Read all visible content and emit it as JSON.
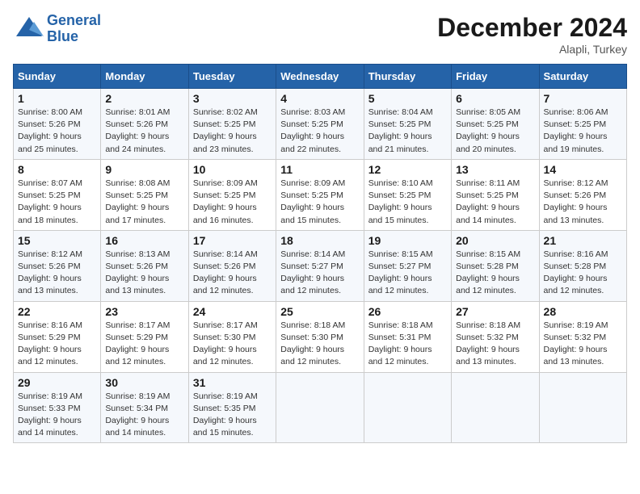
{
  "header": {
    "logo_line1": "General",
    "logo_line2": "Blue",
    "month_title": "December 2024",
    "location": "Alapli, Turkey"
  },
  "days_of_week": [
    "Sunday",
    "Monday",
    "Tuesday",
    "Wednesday",
    "Thursday",
    "Friday",
    "Saturday"
  ],
  "weeks": [
    [
      {
        "day": "1",
        "sunrise": "Sunrise: 8:00 AM",
        "sunset": "Sunset: 5:26 PM",
        "daylight": "Daylight: 9 hours and 25 minutes."
      },
      {
        "day": "2",
        "sunrise": "Sunrise: 8:01 AM",
        "sunset": "Sunset: 5:26 PM",
        "daylight": "Daylight: 9 hours and 24 minutes."
      },
      {
        "day": "3",
        "sunrise": "Sunrise: 8:02 AM",
        "sunset": "Sunset: 5:25 PM",
        "daylight": "Daylight: 9 hours and 23 minutes."
      },
      {
        "day": "4",
        "sunrise": "Sunrise: 8:03 AM",
        "sunset": "Sunset: 5:25 PM",
        "daylight": "Daylight: 9 hours and 22 minutes."
      },
      {
        "day": "5",
        "sunrise": "Sunrise: 8:04 AM",
        "sunset": "Sunset: 5:25 PM",
        "daylight": "Daylight: 9 hours and 21 minutes."
      },
      {
        "day": "6",
        "sunrise": "Sunrise: 8:05 AM",
        "sunset": "Sunset: 5:25 PM",
        "daylight": "Daylight: 9 hours and 20 minutes."
      },
      {
        "day": "7",
        "sunrise": "Sunrise: 8:06 AM",
        "sunset": "Sunset: 5:25 PM",
        "daylight": "Daylight: 9 hours and 19 minutes."
      }
    ],
    [
      {
        "day": "8",
        "sunrise": "Sunrise: 8:07 AM",
        "sunset": "Sunset: 5:25 PM",
        "daylight": "Daylight: 9 hours and 18 minutes."
      },
      {
        "day": "9",
        "sunrise": "Sunrise: 8:08 AM",
        "sunset": "Sunset: 5:25 PM",
        "daylight": "Daylight: 9 hours and 17 minutes."
      },
      {
        "day": "10",
        "sunrise": "Sunrise: 8:09 AM",
        "sunset": "Sunset: 5:25 PM",
        "daylight": "Daylight: 9 hours and 16 minutes."
      },
      {
        "day": "11",
        "sunrise": "Sunrise: 8:09 AM",
        "sunset": "Sunset: 5:25 PM",
        "daylight": "Daylight: 9 hours and 15 minutes."
      },
      {
        "day": "12",
        "sunrise": "Sunrise: 8:10 AM",
        "sunset": "Sunset: 5:25 PM",
        "daylight": "Daylight: 9 hours and 15 minutes."
      },
      {
        "day": "13",
        "sunrise": "Sunrise: 8:11 AM",
        "sunset": "Sunset: 5:25 PM",
        "daylight": "Daylight: 9 hours and 14 minutes."
      },
      {
        "day": "14",
        "sunrise": "Sunrise: 8:12 AM",
        "sunset": "Sunset: 5:26 PM",
        "daylight": "Daylight: 9 hours and 13 minutes."
      }
    ],
    [
      {
        "day": "15",
        "sunrise": "Sunrise: 8:12 AM",
        "sunset": "Sunset: 5:26 PM",
        "daylight": "Daylight: 9 hours and 13 minutes."
      },
      {
        "day": "16",
        "sunrise": "Sunrise: 8:13 AM",
        "sunset": "Sunset: 5:26 PM",
        "daylight": "Daylight: 9 hours and 13 minutes."
      },
      {
        "day": "17",
        "sunrise": "Sunrise: 8:14 AM",
        "sunset": "Sunset: 5:26 PM",
        "daylight": "Daylight: 9 hours and 12 minutes."
      },
      {
        "day": "18",
        "sunrise": "Sunrise: 8:14 AM",
        "sunset": "Sunset: 5:27 PM",
        "daylight": "Daylight: 9 hours and 12 minutes."
      },
      {
        "day": "19",
        "sunrise": "Sunrise: 8:15 AM",
        "sunset": "Sunset: 5:27 PM",
        "daylight": "Daylight: 9 hours and 12 minutes."
      },
      {
        "day": "20",
        "sunrise": "Sunrise: 8:15 AM",
        "sunset": "Sunset: 5:28 PM",
        "daylight": "Daylight: 9 hours and 12 minutes."
      },
      {
        "day": "21",
        "sunrise": "Sunrise: 8:16 AM",
        "sunset": "Sunset: 5:28 PM",
        "daylight": "Daylight: 9 hours and 12 minutes."
      }
    ],
    [
      {
        "day": "22",
        "sunrise": "Sunrise: 8:16 AM",
        "sunset": "Sunset: 5:29 PM",
        "daylight": "Daylight: 9 hours and 12 minutes."
      },
      {
        "day": "23",
        "sunrise": "Sunrise: 8:17 AM",
        "sunset": "Sunset: 5:29 PM",
        "daylight": "Daylight: 9 hours and 12 minutes."
      },
      {
        "day": "24",
        "sunrise": "Sunrise: 8:17 AM",
        "sunset": "Sunset: 5:30 PM",
        "daylight": "Daylight: 9 hours and 12 minutes."
      },
      {
        "day": "25",
        "sunrise": "Sunrise: 8:18 AM",
        "sunset": "Sunset: 5:30 PM",
        "daylight": "Daylight: 9 hours and 12 minutes."
      },
      {
        "day": "26",
        "sunrise": "Sunrise: 8:18 AM",
        "sunset": "Sunset: 5:31 PM",
        "daylight": "Daylight: 9 hours and 12 minutes."
      },
      {
        "day": "27",
        "sunrise": "Sunrise: 8:18 AM",
        "sunset": "Sunset: 5:32 PM",
        "daylight": "Daylight: 9 hours and 13 minutes."
      },
      {
        "day": "28",
        "sunrise": "Sunrise: 8:19 AM",
        "sunset": "Sunset: 5:32 PM",
        "daylight": "Daylight: 9 hours and 13 minutes."
      }
    ],
    [
      {
        "day": "29",
        "sunrise": "Sunrise: 8:19 AM",
        "sunset": "Sunset: 5:33 PM",
        "daylight": "Daylight: 9 hours and 14 minutes."
      },
      {
        "day": "30",
        "sunrise": "Sunrise: 8:19 AM",
        "sunset": "Sunset: 5:34 PM",
        "daylight": "Daylight: 9 hours and 14 minutes."
      },
      {
        "day": "31",
        "sunrise": "Sunrise: 8:19 AM",
        "sunset": "Sunset: 5:35 PM",
        "daylight": "Daylight: 9 hours and 15 minutes."
      },
      null,
      null,
      null,
      null
    ]
  ]
}
